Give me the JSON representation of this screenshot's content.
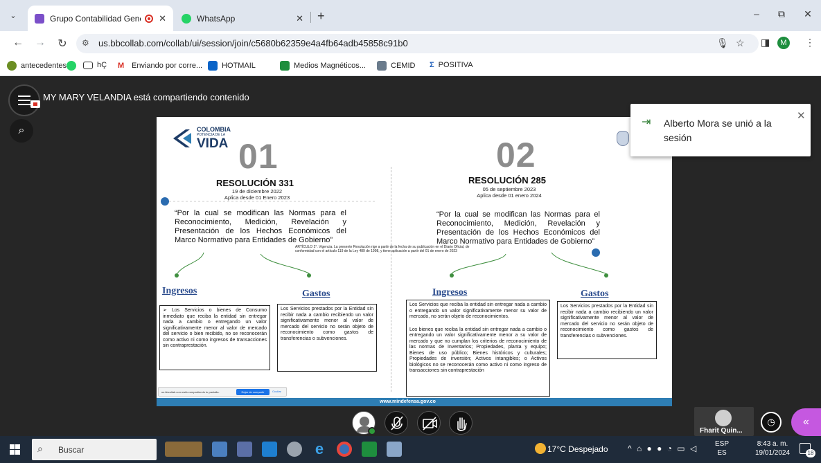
{
  "colors": {
    "accent": "#2a4b8d",
    "brand_blue": "#1d3b66",
    "dot_blue": "#2b6cb0",
    "green": "#3f8f3f",
    "record_red": "#d93025",
    "panel_purple": "#c558e0"
  },
  "browser": {
    "tabs": [
      {
        "title": "Grupo Contabilidad Genera",
        "icon": "blackboard-icon",
        "active": true
      },
      {
        "title": "WhatsApp",
        "icon": "whatsapp-icon",
        "active": false
      }
    ],
    "url": "us.bbcollab.com/collab/ui/session/join/c5680b62359e4a4fb64adb45858c91b0",
    "profile_initial": "M",
    "bookmarks": [
      "antecedentes",
      "",
      "hÇ",
      "Enviando por corre...",
      "HOTMAIL",
      "Medios Magnéticos...",
      "CEMID",
      "POSITIVA"
    ]
  },
  "session": {
    "sharing_text": "MY MARY VELANDIA está compartiendo contenido",
    "toast": "Alberto Mora se unió a la sesión",
    "participant_name": "Fharit Quin..."
  },
  "slide": {
    "logo": {
      "line1": "COLOMBIA",
      "line2": "POTENCIA DE LA",
      "line3": "VIDA"
    },
    "left": {
      "number": "01",
      "title": "RESOLUCIÓN 331",
      "date": "19 de diciembre 2022",
      "applies": "Aplica desde 01 Enero 2023",
      "quote": "“Por la cual se modifican las Normas para el Reconocimiento, Medición, Revelación y Presentación de los Hechos Económicos del Marco Normativo para Entidades de Gobierno”",
      "ingresos_heading": "Ingresos",
      "gastos_heading": "Gastos",
      "ingresos_text": "➢ Los Servicios o bienes de Consumo inmediato que reciba la entidad sin entregar nada a cambio o entregando un valor significativamente menor al valor de mercado del servicio o bien recibido, no se reconocerán como activo ni como ingresos de transacciones sin contraprestación.",
      "gastos_text": "Los Servicios prestados por la Entidad sin recibir nada a cambio recibiendo un valor significativamente menor al valor de mercado del servicio no serán objeto de reconocimiento como gastos de transferencias o subvenciones."
    },
    "right": {
      "number": "02",
      "title": "RESOLUCIÓN 285",
      "date": "05 de septiembre 2023",
      "applies": "Aplica desde 01 enero 2024",
      "quote": "“Por la cual se modifican las Normas para el Reconocimiento, Medición, Revelación y Presentación de los Hechos Económicos del Marco Normativo para Entidades de Gobierno”",
      "ingresos_heading": "Ingresos",
      "gastos_heading": "Gastos",
      "ingresos_text_1": "Los Servicios que reciba la entidad sin entregar nada a cambio o entregando un valor significativamente menor su valor de mercado, no serán objeto de reconocimientos.",
      "ingresos_text_2": "Los bienes que reciba la entidad sin entregar nada a cambio o entregando un valor significativamente menor a su valor de mercado y que no cumplan los criterios de reconocimiento de las normas de Inventarios; Propiedades, planta y equipo; Bienes de uso público; Bienes históricos y culturales; Propiedades de inversión; Activos intangibles; o Activos biológicos no se reconocerán como activo ni como ingreso de transacciones sin contraprestación",
      "gastos_text": "Los Servicios prestados por la Entidad sin recibir nada a cambio recibiendo un valor significativamente menor al valor de mercado del servicio no serán objeto de reconocimiento como gastos de transferencias o subvenciones."
    },
    "article": "ARTÍCULO 2°. Vigencia. La presente Resolución rige a partir de la fecha de su publicación en el Diario Oficial, de conformidad con el artículo 119 de la Ley 489 de 1998, y tiene aplicación a partir del 01 de enero de 2023",
    "footer_url": "www.mindefensa.gov.co",
    "share_bar": {
      "text": "us.bbcollab.com está compartiendo tu pantalla.",
      "stop": "Dejar de compartir",
      "hide": "Ocultar"
    }
  },
  "taskbar": {
    "search_label": "Buscar",
    "weather": "17°C Despejado",
    "lang_top": "ESP",
    "lang_bottom": "ES",
    "time": "8:43 a. m.",
    "date": "19/01/2024",
    "notif_count": "18"
  }
}
